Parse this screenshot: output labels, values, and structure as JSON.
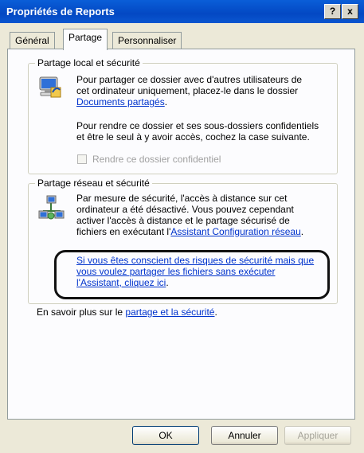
{
  "window": {
    "title": "Propriétés de Reports",
    "help_label": "?",
    "close_label": "x"
  },
  "tabs": [
    "Général",
    "Partage",
    "Personnaliser"
  ],
  "local": {
    "title": "Partage local et sécurité",
    "p1_line1": "Pour partager ce dossier avec d'autres utilisateurs de",
    "p1_line2": "cet ordinateur uniquement, placez-le dans le dossier",
    "p1_link": "Documents partagés",
    "p1_end": ".",
    "p2_line1": "Pour rendre ce dossier et ses sous-dossiers confidentiels",
    "p2_line2": "et être le seul à y avoir accès, cochez la case suivante.",
    "checkbox_label": "Rendre ce dossier confidentiel",
    "checkbox_checked": false
  },
  "network": {
    "title": "Partage réseau et sécurité",
    "p1_line1": "Par mesure de sécurité, l'accès à distance sur cet",
    "p1_line2": "ordinateur a été désactivé. Vous pouvez cependant",
    "p1_line3": "activer l'accès à distance et le partage sécurisé de",
    "p1_line4_pre": "fichiers en exécutant l'",
    "p1_link": "Assistant Configuration réseau",
    "p1_end": ".",
    "risk_line1": "Si vous êtes conscient des risques de sécurité mais que",
    "risk_line2": "vous voulez partager les fichiers sans exécuter",
    "risk_line3": "l'Assistant, cliquez ici",
    "risk_end": "."
  },
  "learn_more": {
    "prefix": "En savoir plus sur le ",
    "link": "partage et la sécurité",
    "end": "."
  },
  "buttons": {
    "ok": "OK",
    "cancel": "Annuler",
    "apply": "Appliquer"
  },
  "colors": {
    "titlebar": "#0a5ed8",
    "link": "#0033cc",
    "background": "#ece9d8",
    "panel": "#fcfcfe"
  },
  "icons": {
    "local": "computer-share-icon",
    "network": "network-computers-icon"
  }
}
